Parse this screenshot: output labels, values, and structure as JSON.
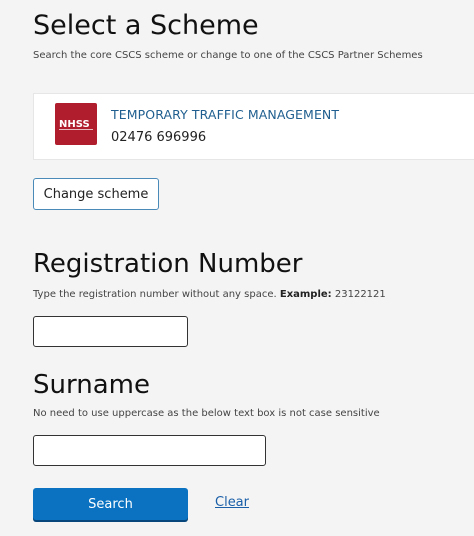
{
  "header": {
    "title": "Select a Scheme",
    "subtitle": "Search the core CSCS scheme or change to one of the CSCS Partner Schemes"
  },
  "scheme": {
    "logo_text": "NHSS",
    "logo_icon": "nhss-logo",
    "name": "TEMPORARY TRAFFIC MANAGEMENT",
    "phone": "02476 696996",
    "colors": {
      "logo_bg": "#b01e2d",
      "name": "#1f5e8f"
    }
  },
  "change_scheme": {
    "label": "Change scheme"
  },
  "registration": {
    "heading": "Registration Number",
    "hint_prefix": "Type the registration number without any space. ",
    "hint_example_label": "Example:",
    "hint_example_value": " 23122121",
    "value": "",
    "placeholder": ""
  },
  "surname": {
    "heading": "Surname",
    "hint": "No need to use uppercase as the below text box is not case sensitive",
    "value": "",
    "placeholder": ""
  },
  "actions": {
    "search_label": "Search",
    "clear_label": "Clear",
    "colors": {
      "search_bg": "#0a72c0",
      "link": "#1a5fa8"
    }
  }
}
